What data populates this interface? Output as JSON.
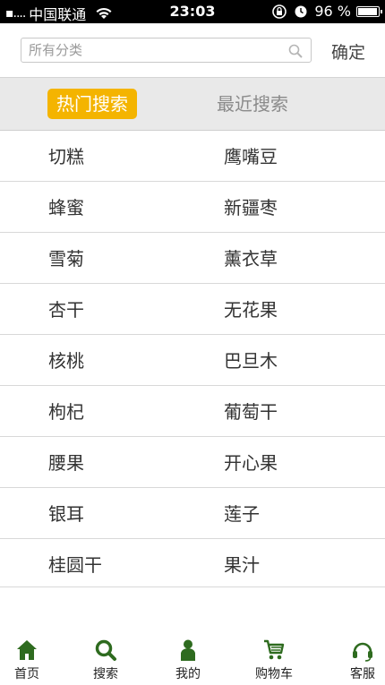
{
  "status_bar": {
    "signal": "▪....",
    "carrier": "中国联通",
    "time": "23:03",
    "battery": "96 %",
    "battery_level_percent": 96
  },
  "search": {
    "placeholder": "所有分类",
    "value": "",
    "confirm_label": "确定"
  },
  "tabs": [
    {
      "label": "热门搜索",
      "active": true
    },
    {
      "label": "最近搜索",
      "active": false
    }
  ],
  "results": [
    {
      "left": "切糕",
      "right": "鹰嘴豆"
    },
    {
      "left": "蜂蜜",
      "right": "新疆枣"
    },
    {
      "left": "雪菊",
      "right": "薰衣草"
    },
    {
      "left": "杏干",
      "right": "无花果"
    },
    {
      "left": "核桃",
      "right": "巴旦木"
    },
    {
      "left": "枸杞",
      "right": "葡萄干"
    },
    {
      "left": "腰果",
      "right": "开心果"
    },
    {
      "left": "银耳",
      "right": "莲子"
    },
    {
      "left": "桂圆干",
      "right": "果汁"
    }
  ],
  "bottom_nav": [
    {
      "label": "首页",
      "icon": "home-icon"
    },
    {
      "label": "搜索",
      "icon": "search-icon"
    },
    {
      "label": "我的",
      "icon": "user-icon"
    },
    {
      "label": "购物车",
      "icon": "cart-icon"
    },
    {
      "label": "客服",
      "icon": "headset-icon"
    }
  ],
  "colors": {
    "accent": "#f4b400",
    "nav_icon": "#2e6b1f",
    "tab_bar_bg": "#e9e9e9"
  }
}
